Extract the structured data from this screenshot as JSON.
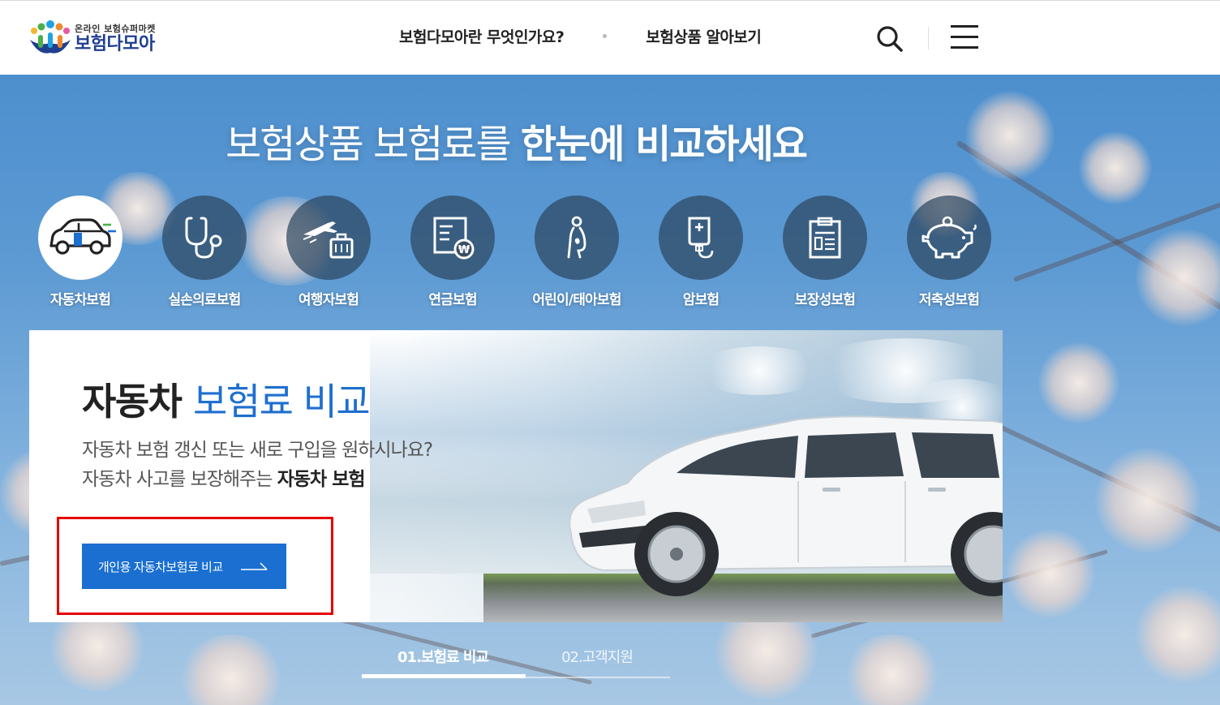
{
  "header": {
    "logo_sub": "온라인 보험슈퍼마켓",
    "logo_main": "보험다모아",
    "nav": [
      "보험다모아란 무엇인가요?",
      "보험상품 알아보기"
    ]
  },
  "hero": {
    "title_light": "보험상품 보험료를",
    "title_strong": "한눈에 비교하세요"
  },
  "categories": [
    {
      "label": "자동차보험",
      "icon": "car-icon",
      "active": true
    },
    {
      "label": "실손의료보험",
      "icon": "stethoscope-icon",
      "active": false
    },
    {
      "label": "여행자보험",
      "icon": "airplane-luggage-icon",
      "active": false
    },
    {
      "label": "연금보험",
      "icon": "pension-document-icon",
      "active": false
    },
    {
      "label": "어린이/태아보험",
      "icon": "pregnant-woman-icon",
      "active": false
    },
    {
      "label": "암보험",
      "icon": "iv-bag-icon",
      "active": false
    },
    {
      "label": "보장성보험",
      "icon": "clipboard-icon",
      "active": false
    },
    {
      "label": "저축성보험",
      "icon": "piggy-bank-icon",
      "active": false
    }
  ],
  "card": {
    "title_dark": "자동차",
    "title_blue": "보험료 비교",
    "desc_line1": "자동차 보험 갱신 또는 새로 구입을 원하시나요?",
    "desc_line2_prefix": "자동차 사고를 보장해주는",
    "desc_line2_bold": "자동차 보험",
    "cta_label": "개인용 자동차보험료 비교"
  },
  "tabs": [
    {
      "label": "01.보험료 비교",
      "active": true
    },
    {
      "label": "02.고객지원",
      "active": false
    }
  ],
  "colors": {
    "accent": "#1a6fd1",
    "highlight": "#e40000",
    "brand": "#1f3f8f"
  }
}
